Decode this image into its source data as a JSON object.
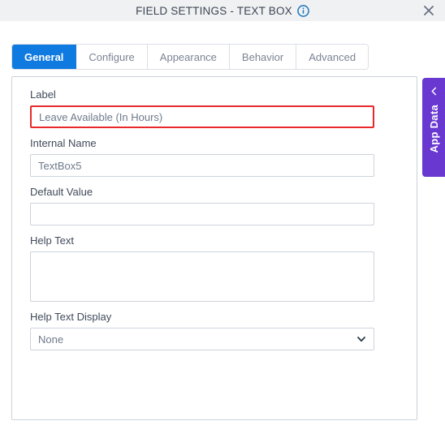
{
  "header": {
    "title": "FIELD SETTINGS - TEXT BOX",
    "info_icon": "info-circle-icon",
    "close_icon": "close-icon"
  },
  "tabs": [
    {
      "label": "General",
      "active": true
    },
    {
      "label": "Configure",
      "active": false
    },
    {
      "label": "Appearance",
      "active": false
    },
    {
      "label": "Behavior",
      "active": false
    },
    {
      "label": "Advanced",
      "active": false
    }
  ],
  "form": {
    "label_field": {
      "label": "Label",
      "value": "Leave Available (In Hours)",
      "placeholder": "",
      "has_error": true
    },
    "internal_name_field": {
      "label": "Internal Name",
      "value": "TextBox5",
      "placeholder": ""
    },
    "default_value_field": {
      "label": "Default Value",
      "value": "",
      "placeholder": ""
    },
    "help_text_field": {
      "label": "Help Text",
      "value": "",
      "placeholder": ""
    },
    "help_text_display_field": {
      "label": "Help Text Display",
      "value": "None",
      "chevron_icon": "chevron-down-icon"
    }
  },
  "side_panel": {
    "label": "App Data",
    "chevron_icon": "chevron-left-icon"
  },
  "colors": {
    "accent_blue": "#0f7ae0",
    "error_red": "#e8292c",
    "app_data_purple": "#6938d0",
    "header_gray": "#f0f1f3",
    "border_gray": "#ccd2db",
    "label_text": "#3f4a5a",
    "input_text": "#6e7a8a"
  }
}
